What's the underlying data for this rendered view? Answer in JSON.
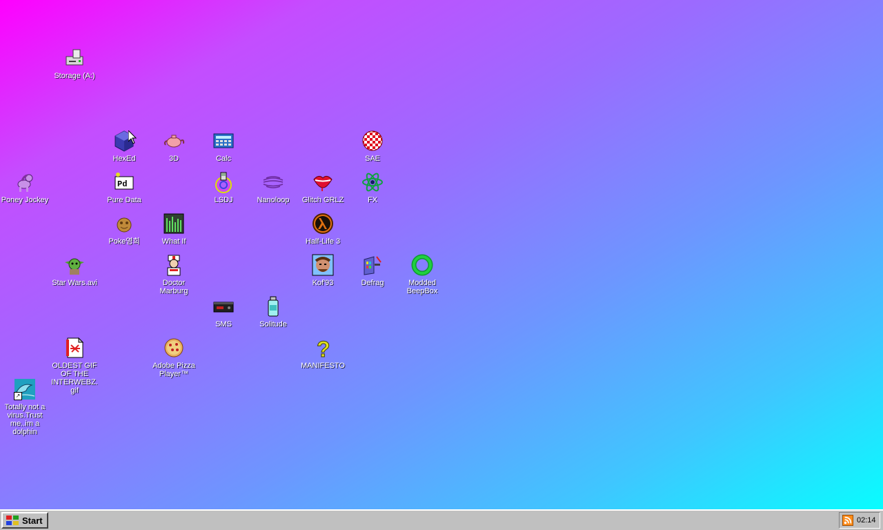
{
  "desktop": {
    "icons": [
      {
        "id": "storage",
        "label": "Storage (A:)",
        "icon": "floppy-drive-icon"
      },
      {
        "id": "hexed",
        "label": "HexEd",
        "icon": "cube-icon"
      },
      {
        "id": "3d",
        "label": "3D",
        "icon": "teapot-icon"
      },
      {
        "id": "calc",
        "label": "Calc",
        "icon": "calculator-icon"
      },
      {
        "id": "sae",
        "label": "SAE",
        "icon": "checkered-ball-icon"
      },
      {
        "id": "poney",
        "label": "Poney Jockey",
        "icon": "pony-icon"
      },
      {
        "id": "puredata",
        "label": "Pure Data",
        "icon": "pd-icon"
      },
      {
        "id": "lsdj",
        "label": "LSDJ",
        "icon": "gameboy-icon"
      },
      {
        "id": "nanoloop",
        "label": "Nanoloop",
        "icon": "wave-icon"
      },
      {
        "id": "glitch",
        "label": "Glitch GRLZ",
        "icon": "lips-icon"
      },
      {
        "id": "fx",
        "label": "FX",
        "icon": "atom-icon"
      },
      {
        "id": "pokegirl",
        "label": "Poke영희",
        "icon": "cookie-face-icon"
      },
      {
        "id": "whatif",
        "label": "What If",
        "icon": "equalizer-icon"
      },
      {
        "id": "halflife",
        "label": "Half-Life 3",
        "icon": "lambda-icon"
      },
      {
        "id": "starwars",
        "label": "Star Wars.avi",
        "icon": "yoda-icon"
      },
      {
        "id": "doctor",
        "label": "Doctor Marburg",
        "icon": "doctor-icon"
      },
      {
        "id": "kof",
        "label": "Kof'93",
        "icon": "fighter-portrait-icon"
      },
      {
        "id": "defrag",
        "label": "Defrag",
        "icon": "defrag-icon"
      },
      {
        "id": "beepbox",
        "label": "Modded BeepBox",
        "icon": "ring-icon"
      },
      {
        "id": "sms",
        "label": "SMS",
        "icon": "console-icon"
      },
      {
        "id": "solitude",
        "label": "Solitude",
        "icon": "bottle-icon"
      },
      {
        "id": "gif",
        "label": "OLDEST GIF OF THE INTERWEBZ.gif",
        "icon": "gif-file-icon"
      },
      {
        "id": "pizza",
        "label": "Adobe Pizza Player™",
        "icon": "pizza-icon"
      },
      {
        "id": "manifesto",
        "label": "MANIFESTO",
        "icon": "question-mark-icon"
      },
      {
        "id": "dolphin",
        "label": "Totally not a virus.Trust me..im a dolphin",
        "icon": "dolphin-icon"
      }
    ]
  },
  "taskbar": {
    "start_label": "Start",
    "clock": "02:14"
  }
}
